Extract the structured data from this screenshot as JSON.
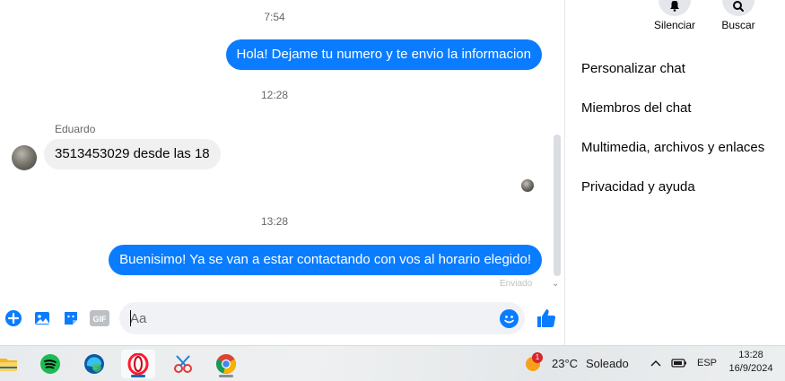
{
  "conversation": {
    "messages": [
      {
        "time": "7:54",
        "text": "Hola! Dejame tu numero y te envio la informacion"
      },
      {
        "time": "12:28",
        "sender": "Eduardo",
        "text": "3513453029 desde las 18"
      },
      {
        "time": "13:28",
        "text": "Buenisimo! Ya se van a estar contactando con vos al horario elegido!",
        "status": "Enviado"
      }
    ]
  },
  "composer": {
    "placeholder": "Aa",
    "icons": [
      "plus-circle-icon",
      "image-icon",
      "sticker-icon",
      "gif-icon",
      "emoji-icon",
      "thumbs-up-icon"
    ],
    "gif_label": "GIF"
  },
  "panel": {
    "actions": [
      {
        "label": "Silenciar",
        "icon": "bell-icon"
      },
      {
        "label": "Buscar",
        "icon": "search-icon"
      }
    ],
    "menu": [
      "Personalizar chat",
      "Miembros del chat",
      "Multimedia, archivos y enlaces",
      "Privacidad y ayuda"
    ]
  },
  "taskbar": {
    "apps": [
      "file-explorer-icon",
      "spotify-icon",
      "edge-icon",
      "opera-icon",
      "snipping-tool-icon",
      "chrome-icon"
    ],
    "weather": {
      "temp": "23°C",
      "condition": "Soleado",
      "badge": "1"
    },
    "language": "ESP",
    "time": "13:28",
    "date": "16/9/2024"
  },
  "colors": {
    "accent": "#0a7cff",
    "incoming_bubble": "#f0f0f0"
  }
}
